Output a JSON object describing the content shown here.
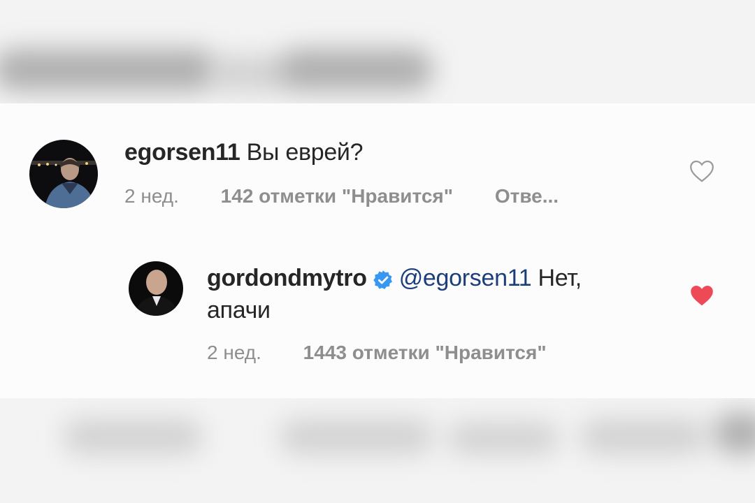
{
  "comments": [
    {
      "username": "egorsen11",
      "text": "Вы еврей?",
      "time": "2 нед.",
      "likes": "142 отметки \"Нравится\"",
      "reply": "Отве...",
      "liked": false
    },
    {
      "username": "gordondmytro",
      "verified": true,
      "mention": "@egorsen11",
      "text_line1": " Нет,",
      "text_line2": "апачи",
      "time": "2 нед.",
      "likes": "1443 отметки \"Нравится\"",
      "liked": true
    }
  ],
  "colors": {
    "liked_heart": "#ed4956",
    "verified_badge": "#3897f0",
    "mention": "#1c3e7a",
    "meta": "#8e8e8e"
  },
  "icons": {
    "heart_outline": "heart-outline-icon",
    "heart_filled": "heart-filled-icon",
    "verified": "verified-badge-icon"
  }
}
